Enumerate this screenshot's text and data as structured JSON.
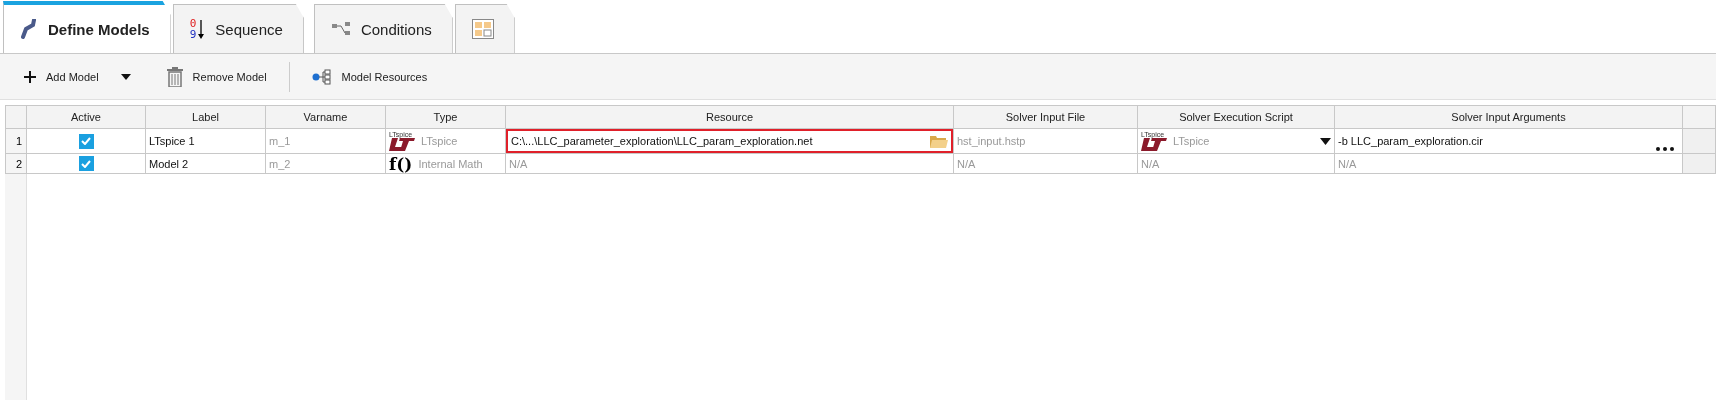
{
  "tabs": [
    {
      "label": "Define Models",
      "kind": "models",
      "selected": true
    },
    {
      "label": "Sequence",
      "kind": "sequence",
      "top_digit": "0",
      "bottom_digit": "9",
      "selected": false
    },
    {
      "label": "Conditions",
      "kind": "conditions",
      "selected": false
    },
    {
      "kind": "layout",
      "selected": false
    }
  ],
  "toolbar": [
    {
      "kind": "add",
      "label": "Add Model"
    },
    {
      "kind": "dropdown"
    },
    {
      "kind": "remove",
      "label": "Remove Model"
    },
    {
      "kind": "separator"
    },
    {
      "kind": "resources",
      "label": "Model Resources"
    }
  ],
  "table": {
    "columns": [
      "Active",
      "Label",
      "Varname",
      "Type",
      "Resource",
      "Solver Input File",
      "Solver Execution Script",
      "Solver Input Arguments"
    ],
    "rows": [
      {
        "number": "1",
        "active": true,
        "label": "LTspice 1",
        "varname": "m_1",
        "type": {
          "kind": "ltspice",
          "logo_caption": "LTspice",
          "text": "LTspice"
        },
        "resource": "C:\\...\\LLC_parameter_exploration\\LLC_param_exploration.net",
        "resource_selected": true,
        "resource_na": false,
        "solver_input_file": "hst_input.hstp",
        "script": {
          "kind": "ltspice",
          "logo_caption": "LTspice",
          "text": "LTspice"
        },
        "arguments": "-b LLC_param_exploration.cir",
        "arguments_na": false
      },
      {
        "number": "2",
        "active": true,
        "label": "Model 2",
        "varname": "m_2",
        "type": {
          "kind": "math",
          "glyph": "f()",
          "text": "Internal Math"
        },
        "resource": "N/A",
        "resource_selected": false,
        "resource_na": true,
        "solver_input_file": "N/A",
        "script": {
          "kind": "none",
          "text": "N/A"
        },
        "arguments": "N/A",
        "arguments_na": true
      }
    ]
  }
}
